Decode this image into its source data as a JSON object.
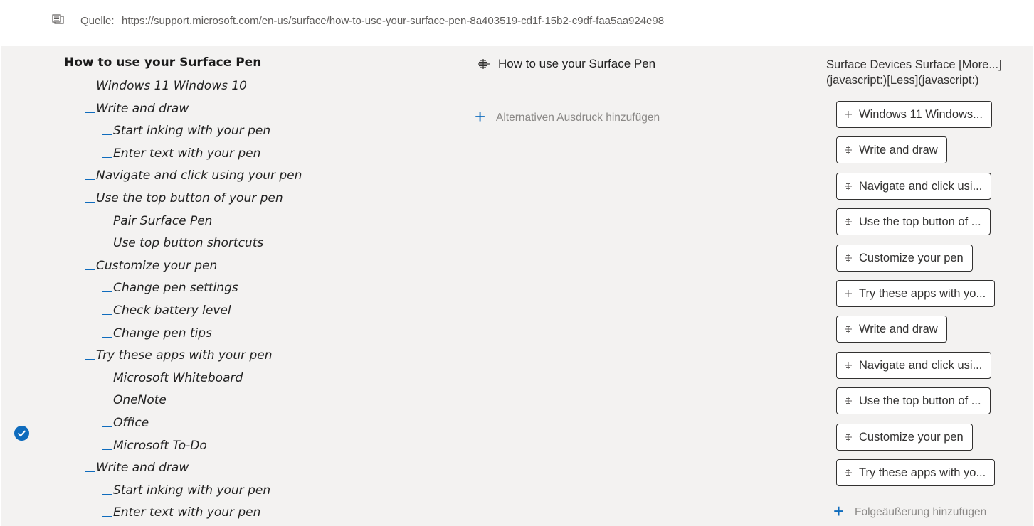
{
  "source": {
    "label": "Quelle:",
    "url": "https://support.microsoft.com/en-us/surface/how-to-use-your-surface-pen-8a403519-cd1f-15b2-c9df-faa5aa924e98",
    "icon": "document-icon"
  },
  "tree": {
    "root": "How to use your Surface Pen",
    "nodes": [
      {
        "label": "Windows 11 Windows 10",
        "level": 1
      },
      {
        "label": "Write and draw",
        "level": 1
      },
      {
        "label": "Start inking with your pen",
        "level": 2
      },
      {
        "label": "Enter text with your pen",
        "level": 2
      },
      {
        "label": "Navigate and click using your pen",
        "level": 1
      },
      {
        "label": "Use the top button of your pen",
        "level": 1
      },
      {
        "label": "Pair Surface Pen",
        "level": 2
      },
      {
        "label": "Use top button shortcuts",
        "level": 2
      },
      {
        "label": "Customize your pen",
        "level": 1
      },
      {
        "label": "Change pen settings",
        "level": 2
      },
      {
        "label": "Check battery level",
        "level": 2
      },
      {
        "label": "Change pen tips",
        "level": 2
      },
      {
        "label": "Try these apps with your pen",
        "level": 1
      },
      {
        "label": "Microsoft Whiteboard",
        "level": 2
      },
      {
        "label": "OneNote",
        "level": 2
      },
      {
        "label": "Office",
        "level": 2
      },
      {
        "label": "Microsoft To-Do",
        "level": 2
      },
      {
        "label": "Write and draw",
        "level": 1
      },
      {
        "label": "Start inking with your pen",
        "level": 2
      },
      {
        "label": "Enter text with your pen",
        "level": 2
      }
    ]
  },
  "middle": {
    "title": "How to use your Surface Pen",
    "add_alternative": "Alternativen Ausdruck hinzufügen"
  },
  "right": {
    "heading": "Surface Devices Surface [More...](javascript:)[Less](javascript:)",
    "chips": [
      "Windows 11 Windows...",
      "Write and draw",
      "Navigate and click usi...",
      "Use the top button of ...",
      "Customize your pen",
      "Try these apps with yo...",
      "Write and draw",
      "Navigate and click usi...",
      "Use the top button of ...",
      "Customize your pen",
      "Try these apps with yo..."
    ],
    "add_followup": "Folgeäußerung hinzufügen"
  },
  "colors": {
    "accent": "#0f6cbd",
    "panel_bg": "#f3f2f1"
  }
}
